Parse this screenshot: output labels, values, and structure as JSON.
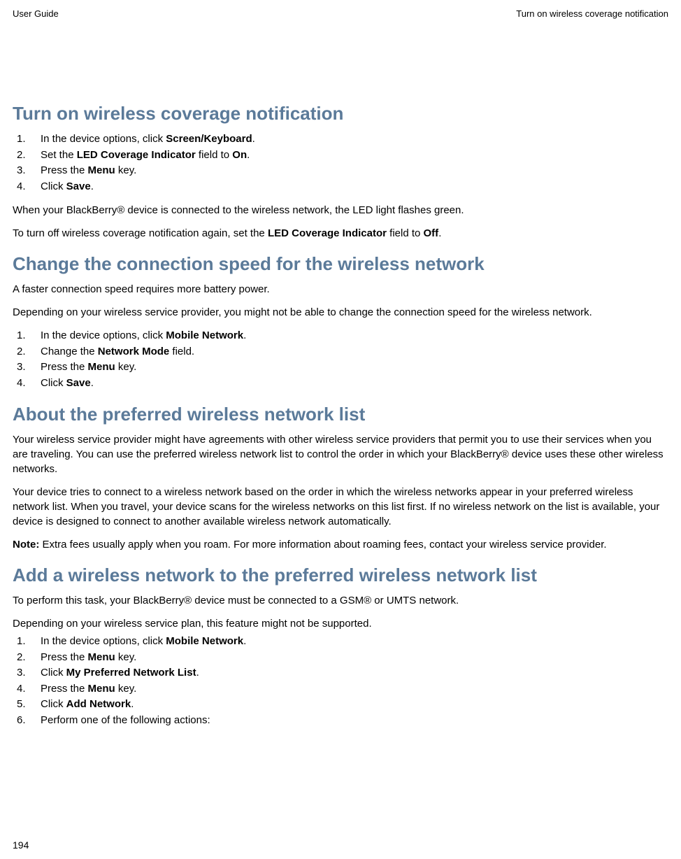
{
  "header": {
    "left": "User Guide",
    "right": "Turn on wireless coverage notification"
  },
  "page_number": "194",
  "sections": {
    "s1": {
      "title": "Turn on wireless coverage notification",
      "steps": {
        "step1_pre": "In the device options, click ",
        "step1_bold": "Screen/Keyboard",
        "step1_post": ".",
        "step2_pre": "Set the ",
        "step2_bold": "LED Coverage Indicator",
        "step2_mid": " field to ",
        "step2_bold2": "On",
        "step2_post": ".",
        "step3_pre": "Press the ",
        "step3_bold": "Menu",
        "step3_post": " key.",
        "step4_pre": "Click ",
        "step4_bold": "Save",
        "step4_post": "."
      },
      "p1": "When your BlackBerry® device is connected to the wireless network, the LED light flashes green.",
      "p2_pre": "To turn off wireless coverage notification again, set the ",
      "p2_bold": "LED Coverage Indicator",
      "p2_mid": " field to ",
      "p2_bold2": "Off",
      "p2_post": "."
    },
    "s2": {
      "title": "Change the connection speed for the wireless network",
      "p1": "A faster connection speed requires more battery power.",
      "p2": "Depending on your wireless service provider, you might not be able to change the connection speed for the wireless network.",
      "steps": {
        "step1_pre": "In the device options, click ",
        "step1_bold": "Mobile Network",
        "step1_post": ".",
        "step2_pre": "Change the ",
        "step2_bold": "Network Mode",
        "step2_post": " field.",
        "step3_pre": "Press the ",
        "step3_bold": "Menu",
        "step3_post": " key.",
        "step4_pre": "Click ",
        "step4_bold": "Save",
        "step4_post": "."
      }
    },
    "s3": {
      "title": "About the preferred wireless network list",
      "p1": "Your wireless service provider might have agreements with other wireless service providers that permit you to use their services when you are traveling. You can use the preferred wireless network list to control the order in which your BlackBerry® device uses these other wireless networks.",
      "p2": "Your device tries to connect to a wireless network based on the order in which the wireless networks appear in your preferred wireless network list. When you travel, your device scans for the wireless networks on this list first. If no wireless network on the list is available, your device is designed to connect to another available wireless network automatically.",
      "p3_bold": "Note:",
      "p3_post": "  Extra fees usually apply when you roam. For more information about roaming fees, contact your wireless service provider."
    },
    "s4": {
      "title": "Add a wireless network to the preferred wireless network list",
      "p1": "To perform this task, your BlackBerry® device must be connected to a GSM® or UMTS network.",
      "p2": "Depending on your wireless service plan, this feature might not be supported.",
      "steps": {
        "step1_pre": "In the device options, click ",
        "step1_bold": "Mobile Network",
        "step1_post": ".",
        "step2_pre": "Press the ",
        "step2_bold": "Menu",
        "step2_post": " key.",
        "step3_pre": "Click ",
        "step3_bold": "My Preferred Network List",
        "step3_post": ".",
        "step4_pre": "Press the ",
        "step4_bold": "Menu",
        "step4_post": " key.",
        "step5_pre": "Click ",
        "step5_bold": "Add Network",
        "step5_post": ".",
        "step6": "Perform one of the following actions:"
      }
    }
  }
}
